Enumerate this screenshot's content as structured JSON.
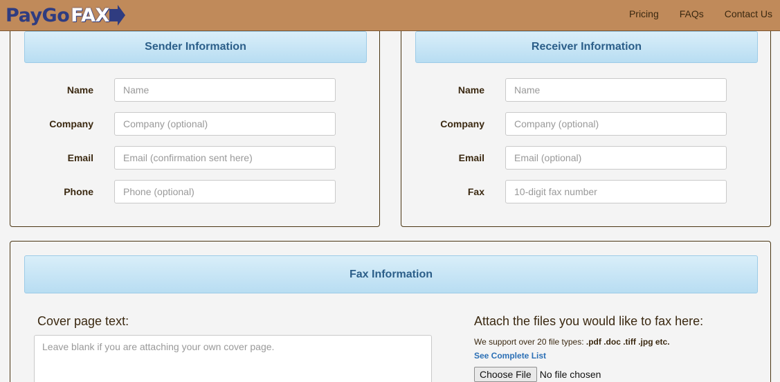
{
  "header": {
    "logo_part1": "PayGo",
    "logo_part2": "FAX",
    "nav": [
      "Pricing",
      "FAQs",
      "Contact Us"
    ]
  },
  "sender": {
    "title": "Sender Information",
    "fields": [
      {
        "label": "Name",
        "placeholder": "Name",
        "value": ""
      },
      {
        "label": "Company",
        "placeholder": "Company (optional)",
        "value": ""
      },
      {
        "label": "Email",
        "placeholder": "Email (confirmation sent here)",
        "value": ""
      },
      {
        "label": "Phone",
        "placeholder": "Phone (optional)",
        "value": ""
      }
    ]
  },
  "receiver": {
    "title": "Receiver Information",
    "fields": [
      {
        "label": "Name",
        "placeholder": "Name",
        "value": ""
      },
      {
        "label": "Company",
        "placeholder": "Company (optional)",
        "value": ""
      },
      {
        "label": "Email",
        "placeholder": "Email (optional)",
        "value": ""
      },
      {
        "label": "Fax",
        "placeholder": "10-digit fax number",
        "value": ""
      }
    ]
  },
  "fax": {
    "title": "Fax Information",
    "cover_label": "Cover page text:",
    "cover_placeholder": "Leave blank if you are attaching your own cover page.",
    "attach_label": "Attach the files you would like to fax here:",
    "support_text": "We support over 20 file types:",
    "support_types": ".pdf .doc .tiff .jpg etc.",
    "complete_list": "See Complete List",
    "choose_file": "Choose File",
    "file_status": "No file chosen"
  },
  "colors": {
    "header_bg": "#c08a5a",
    "logo_blue": "#2f3c80",
    "panel_head_text": "#2b5e89",
    "link": "#2b6fb5"
  }
}
